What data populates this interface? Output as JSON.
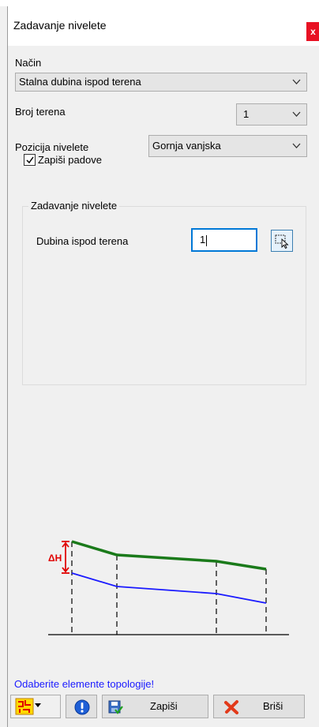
{
  "window": {
    "title": "Zadavanje nivelete",
    "close_label": "x"
  },
  "form": {
    "nacin": {
      "label": "Način",
      "value": "Stalna dubina ispod terena"
    },
    "broj_terena": {
      "label": "Broj terena",
      "value": "1"
    },
    "pozicija": {
      "label": "Pozicija nivelete",
      "value": "Gornja vanjska"
    },
    "zapisi_padove": {
      "label": "Zapiši padove",
      "checked": true
    }
  },
  "group": {
    "title": "Zadavanje nivelete",
    "dubina_label": "Dubina ispod terena",
    "dubina_value": "1"
  },
  "diagram": {
    "delta_label": "ΔH",
    "terrain_color": "#1a7a1a",
    "niveleta_color": "#1a1aff",
    "marker_color": "#e00000"
  },
  "status_text": "Odaberite elemente topologije!",
  "buttons": {
    "save_label": "Zapiši",
    "delete_label": "Briši"
  }
}
